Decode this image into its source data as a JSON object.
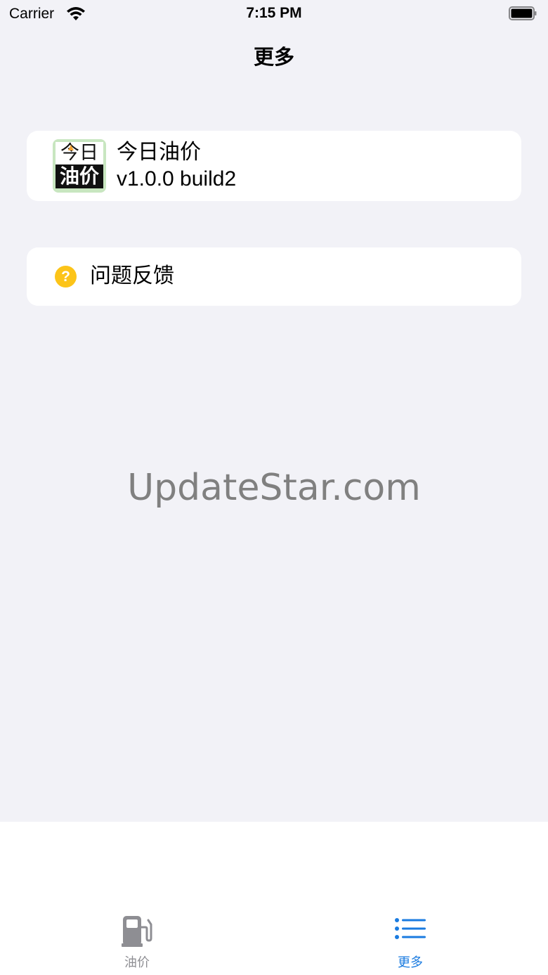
{
  "status_bar": {
    "carrier": "Carrier",
    "time": "7:15 PM"
  },
  "nav": {
    "title": "更多"
  },
  "app_card": {
    "icon_text_top": "今日",
    "icon_text_bottom": "油价",
    "name": "今日油价",
    "version": "v1.0.0 build2"
  },
  "feedback_card": {
    "icon_glyph": "?",
    "label": "问题反馈"
  },
  "watermark": "UpdateStar.com",
  "tab_bar": {
    "tabs": [
      {
        "label": "油价",
        "icon": "fuel-pump-icon",
        "selected": false
      },
      {
        "label": "更多",
        "icon": "list-icon",
        "selected": true
      }
    ]
  },
  "colors": {
    "background": "#f2f2f7",
    "accent": "#1a7be0",
    "inactive_tab": "#8e8e93",
    "help_icon": "#fcc419"
  }
}
